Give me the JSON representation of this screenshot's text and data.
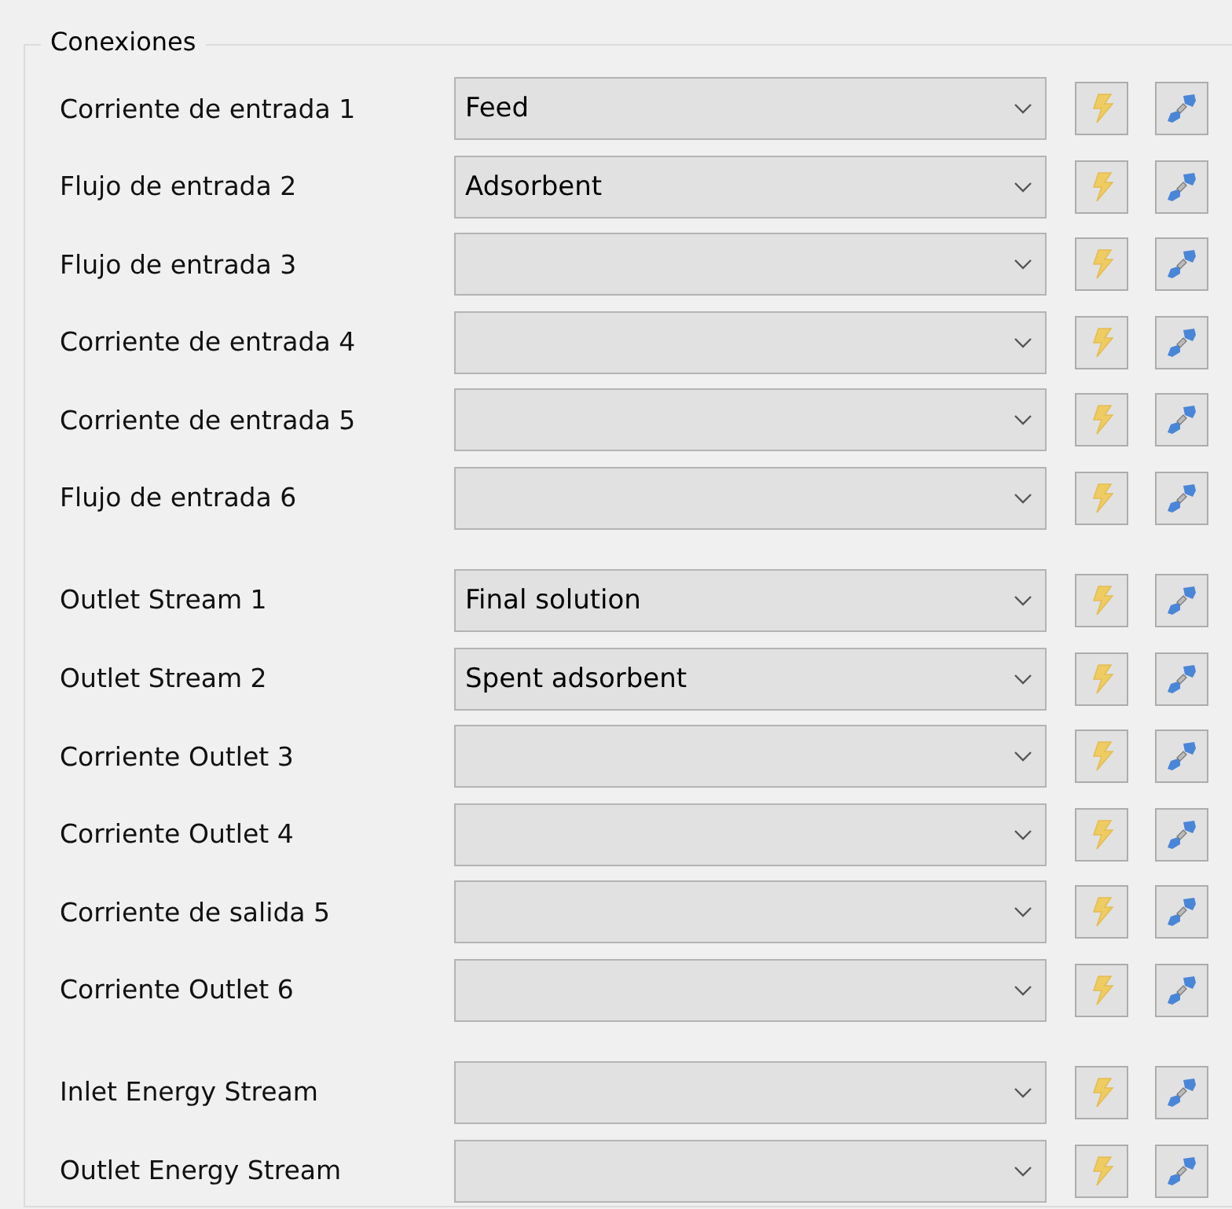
{
  "group": {
    "title": "Conexiones"
  },
  "sections": [
    {
      "rows": [
        {
          "label": "Corriente de entrada 1",
          "value": "Feed"
        },
        {
          "label": "Flujo de entrada 2",
          "value": "Adsorbent"
        },
        {
          "label": "Flujo de entrada 3"
        },
        {
          "label": "Corriente de entrada 4"
        },
        {
          "label": "Corriente de entrada 5"
        },
        {
          "label": "Flujo de entrada 6"
        }
      ]
    },
    {
      "rows": [
        {
          "label": "Outlet Stream 1",
          "value": "Final solution"
        },
        {
          "label": "Outlet Stream 2",
          "value": "Spent adsorbent"
        },
        {
          "label": "Corriente Outlet 3"
        },
        {
          "label": "Corriente Outlet 4"
        },
        {
          "label": "Corriente de salida 5"
        },
        {
          "label": "Corriente Outlet 6"
        }
      ]
    },
    {
      "rows": [
        {
          "label": "Inlet Energy Stream"
        },
        {
          "label": "Outlet Energy Stream"
        }
      ]
    }
  ]
}
